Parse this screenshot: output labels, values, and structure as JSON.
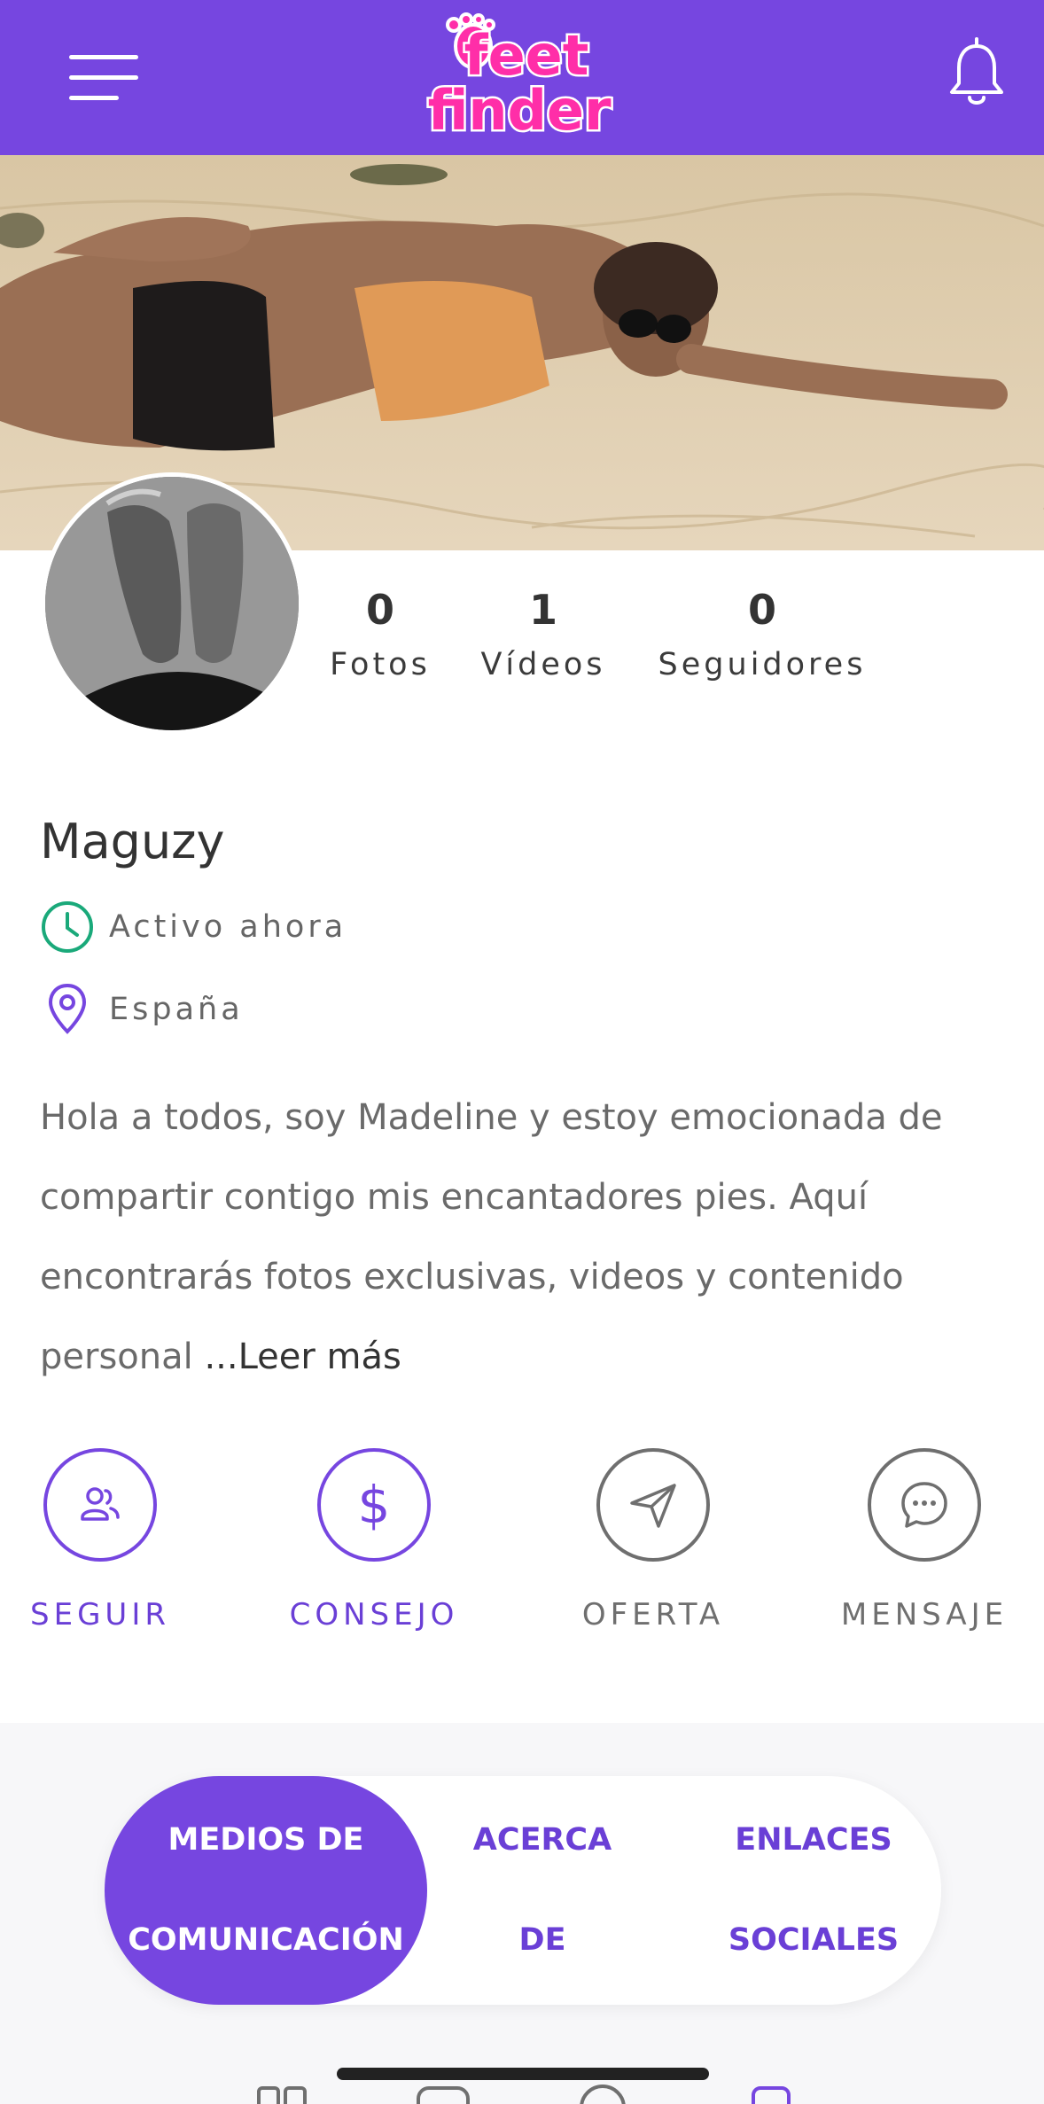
{
  "header": {
    "logo_line1": "feet",
    "logo_line2": "finder",
    "menu_icon": "hamburger-icon",
    "notification_icon": "bell-icon"
  },
  "profile": {
    "cover_image": "beach-photo",
    "avatar_image": "legs-photo",
    "stats": [
      {
        "value": "0",
        "label": "Fotos"
      },
      {
        "value": "1",
        "label": "Vídeos"
      },
      {
        "value": "0",
        "label": "Seguidores"
      }
    ],
    "name": "Maguzy",
    "status": "Activo ahora",
    "location": "España",
    "bio": "Hola a todos, soy Madeline y estoy emocionada de compartir contigo mis encantadores pies. Aquí encontrarás fotos exclusivas, videos y contenido personal",
    "read_more": "...Leer más"
  },
  "actions": [
    {
      "label": "SEGUIR",
      "icon": "follow-users-icon"
    },
    {
      "label": "CONSEJO",
      "icon": "dollar-icon"
    },
    {
      "label": "OFERTA",
      "icon": "paper-plane-icon"
    },
    {
      "label": "MENSAJE",
      "icon": "chat-bubble-icon"
    }
  ],
  "tabs": {
    "active_line1": "MEDIOS DE",
    "active_line2": "COMUNICACIÓN",
    "about": "ACERCA DE",
    "links_line1": "ENLACES",
    "links_line2": "SOCIALES"
  },
  "colors": {
    "brand": "#7646e0",
    "active_green": "#1aa97a",
    "logo_pink": "#ff2ea8"
  }
}
